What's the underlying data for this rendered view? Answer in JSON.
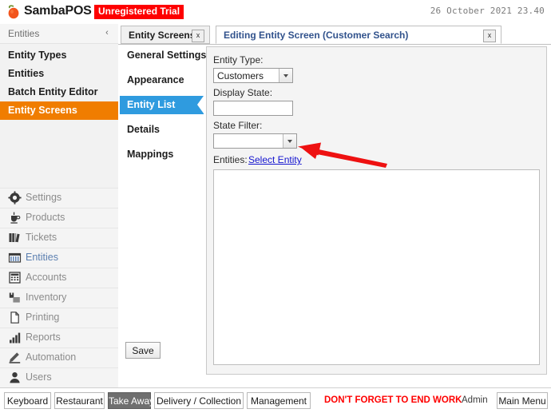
{
  "topbar": {
    "logo_icon": "tomato-logo-icon",
    "brand": "SambaPOS",
    "trial_badge": "Unregistered Trial",
    "clock": "26 October 2021 23.40"
  },
  "sidebar": {
    "title": "Entities",
    "collapse_icon": "chevron-left-icon",
    "items": [
      {
        "label": "Entity Types",
        "active": false
      },
      {
        "label": "Entities",
        "active": false
      },
      {
        "label": "Batch Entity Editor",
        "active": false
      },
      {
        "label": "Entity Screens",
        "active": true
      }
    ],
    "modules": [
      {
        "label": "Settings",
        "icon": "gear-icon",
        "selected": false
      },
      {
        "label": "Products",
        "icon": "cup-icon",
        "selected": false
      },
      {
        "label": "Tickets",
        "icon": "books-icon",
        "selected": false
      },
      {
        "label": "Entities",
        "icon": "grid-icon",
        "selected": true
      },
      {
        "label": "Accounts",
        "icon": "calculator-icon",
        "selected": false
      },
      {
        "label": "Inventory",
        "icon": "boxes-icon",
        "selected": false
      },
      {
        "label": "Printing",
        "icon": "page-icon",
        "selected": false
      },
      {
        "label": "Reports",
        "icon": "bar-chart-icon",
        "selected": false
      },
      {
        "label": "Automation",
        "icon": "pencil-icon",
        "selected": false
      },
      {
        "label": "Users",
        "icon": "person-icon",
        "selected": false
      }
    ]
  },
  "tabs": [
    {
      "label": "Entity Screens",
      "active": false,
      "close_icon": "close-icon"
    },
    {
      "label": "Editing Entity Screen (Customer Search)",
      "active": true,
      "close_icon": "close-icon"
    }
  ],
  "editor": {
    "nav_items": [
      {
        "label": "General Settings",
        "active": false
      },
      {
        "label": "Appearance",
        "active": false
      },
      {
        "label": "Entity List",
        "active": true
      },
      {
        "label": "Details",
        "active": false
      },
      {
        "label": "Mappings",
        "active": false
      }
    ],
    "fields": {
      "entity_type_label": "Entity Type:",
      "entity_type_value": "Customers",
      "display_state_label": "Display State:",
      "display_state_value": "",
      "state_filter_label": "State Filter:",
      "state_filter_value": "",
      "entities_label": "Entities:",
      "select_entity_link": "Select Entity",
      "entities_list": []
    },
    "save_label": "Save"
  },
  "annotation": {
    "arrow_icon": "red-arrow-left-icon",
    "arrow_color": "#ee1111"
  },
  "taskbar": {
    "buttons": [
      {
        "label": "Keyboard",
        "selected": false
      },
      {
        "label": "Restaurant",
        "selected": false
      },
      {
        "label": "Take Away",
        "selected": true
      },
      {
        "label": "Delivery / Collection",
        "selected": false
      },
      {
        "label": "Management",
        "selected": false
      }
    ],
    "warning": "DON'T FORGET TO END WORK PERIOD",
    "user": "Admin",
    "main_menu": "Main Menu"
  },
  "colors": {
    "brand_orange": "#f07d00",
    "trial_red": "#fe0000",
    "accent_blue": "#2f9bdf",
    "link_blue": "#1414cf",
    "warning_red": "#ff0000"
  }
}
